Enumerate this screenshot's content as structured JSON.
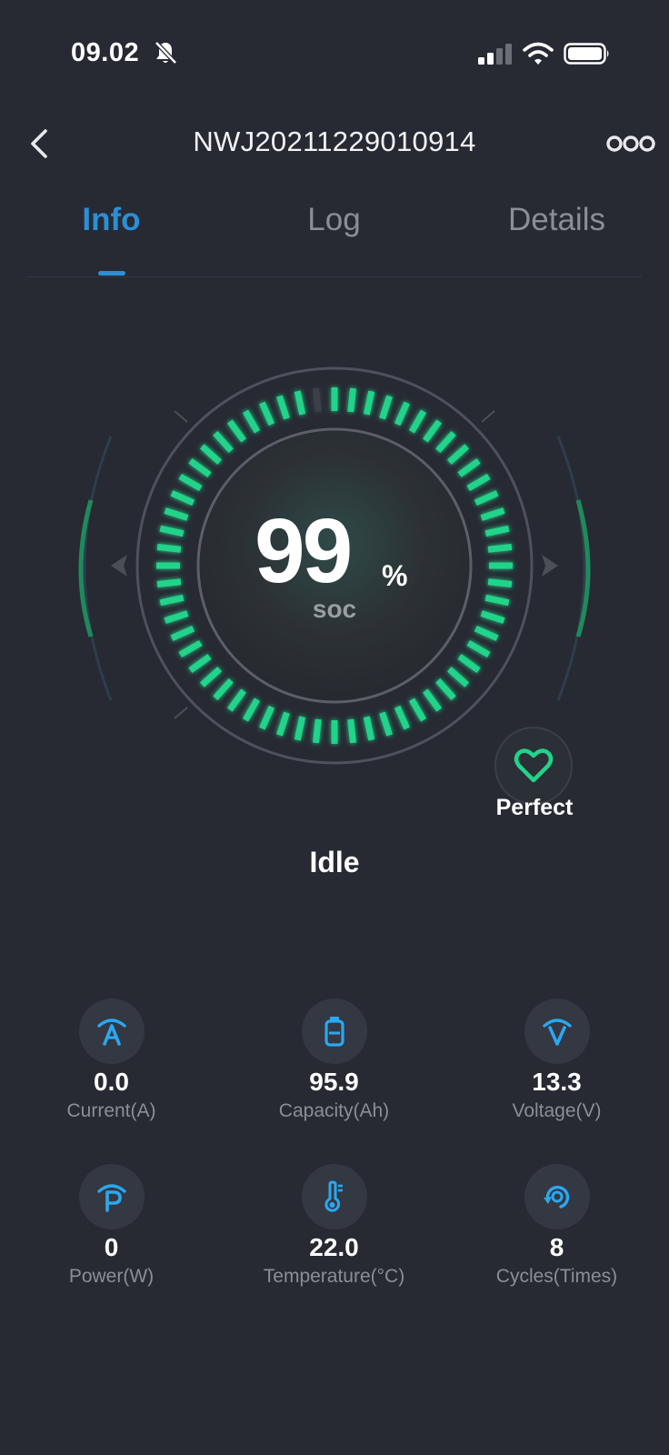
{
  "status_bar": {
    "time": "09.02",
    "icons": [
      "bell-off-icon",
      "cellular-signal-icon",
      "wifi-icon",
      "battery-icon"
    ]
  },
  "header": {
    "title": "NWJ20211229010914",
    "back_icon": "chevron-left-icon",
    "more_icon": "more-dots-icon"
  },
  "tabs": [
    {
      "label": "Info",
      "active": true
    },
    {
      "label": "Log",
      "active": false
    },
    {
      "label": "Details",
      "active": false
    }
  ],
  "gauge": {
    "soc_value": "99",
    "soc_unit": "%",
    "soc_label": "soc",
    "fill_fraction": 0.99
  },
  "health": {
    "label": "Perfect",
    "icon": "heart-icon"
  },
  "state": "Idle",
  "metrics": [
    {
      "value": "0.0",
      "label": "Current(A)",
      "icon": "current-icon"
    },
    {
      "value": "95.9",
      "label": "Capacity(Ah)",
      "icon": "capacity-icon"
    },
    {
      "value": "13.3",
      "label": "Voltage(V)",
      "icon": "voltage-icon"
    },
    {
      "value": "0",
      "label": "Power(W)",
      "icon": "power-icon"
    },
    {
      "value": "22.0",
      "label": "Temperature(°C)",
      "icon": "temperature-icon"
    },
    {
      "value": "8",
      "label": "Cycles(Times)",
      "icon": "cycles-icon"
    }
  ],
  "colors": {
    "background": "#272a33",
    "accent": "#2b8fd6",
    "gauge_green": "#22d38a",
    "icon_blue": "#2aa8f0",
    "muted_text": "#8a8e96"
  }
}
